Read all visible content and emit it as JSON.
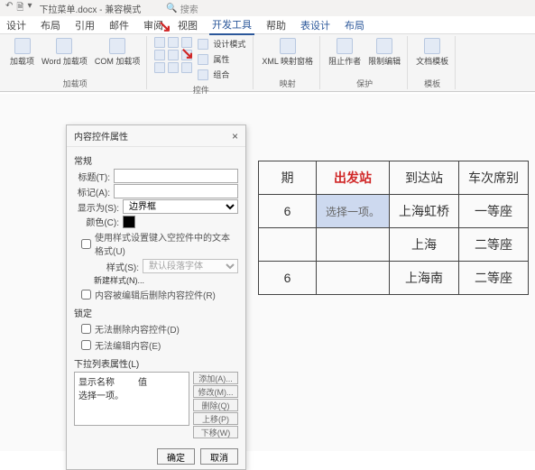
{
  "titlebar": {
    "doc_title": "下拉菜单.docx - 兼容模式",
    "search": "搜索"
  },
  "tabs": {
    "t0": "设计",
    "t1": "布局",
    "t2": "引用",
    "t3": "邮件",
    "t4": "审阅",
    "t5": "视图",
    "t6": "开发工具",
    "t7": "帮助",
    "t8": "表设计",
    "t9": "布局"
  },
  "ribbon": {
    "addins": {
      "b0": "加载项",
      "b1": "Word 加载项",
      "b2": "COM 加载项",
      "label": "加载项"
    },
    "controls": {
      "c0": "设计模式",
      "c1": "属性",
      "c2": "组合",
      "label": "控件"
    },
    "mapping": {
      "m0": "XML 映射窗格",
      "label": "映射"
    },
    "protect": {
      "p0": "阻止作者",
      "p1": "限制编辑",
      "label": "保护"
    },
    "template": {
      "t0": "文档模板",
      "label": "模板"
    }
  },
  "table": {
    "h0": "期",
    "h1": "出发站",
    "h2": "到达站",
    "h3": "车次席别",
    "r0": {
      "c0": "6",
      "c1": "选择一项。",
      "c2": "上海虹桥",
      "c3": "一等座"
    },
    "r1": {
      "c0": "",
      "c1": "",
      "c2": "上海",
      "c3": "二等座"
    },
    "r2": {
      "c0": "6",
      "c1": "",
      "c2": "上海南",
      "c3": "二等座"
    }
  },
  "dialog": {
    "title": "内容控件属性",
    "section_general": "常规",
    "title_label": "标题(T):",
    "tag_label": "标记(A):",
    "display_label": "显示为(S):",
    "display_value": "边界框",
    "color_label": "颜色(C):",
    "chk_style": "使用样式设置键入空控件中的文本格式(U)",
    "style_label": "样式(S):",
    "style_value": "默认段落字体",
    "btn_newstyle": "新建样式(N)...",
    "chk_remove": "内容被编辑后删除内容控件(R)",
    "section_lock": "锁定",
    "chk_lock1": "无法删除内容控件(D)",
    "chk_lock2": "无法编辑内容(E)",
    "section_list": "下拉列表属性(L)",
    "list_h0": "显示名称",
    "list_h1": "值",
    "list_item0": "选择一项。",
    "btn_add": "添加(A)...",
    "btn_modify": "修改(M)...",
    "btn_delete": "删除(Q)",
    "btn_up": "上移(P)",
    "btn_down": "下移(W)",
    "btn_ok": "确定",
    "btn_cancel": "取消"
  }
}
